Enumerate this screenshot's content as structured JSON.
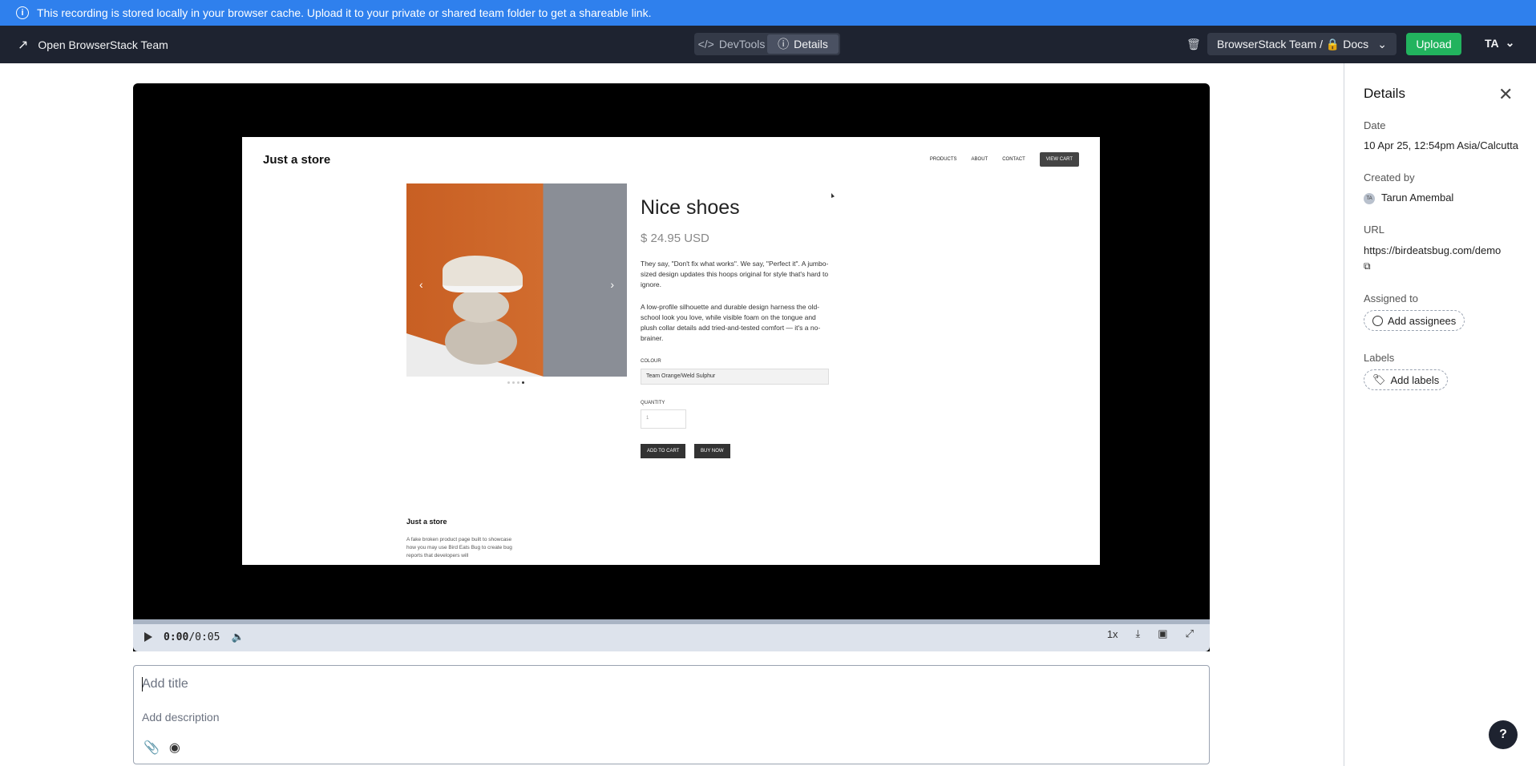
{
  "banner": {
    "text": "This recording is stored locally in your browser cache. Upload it to your private or shared team folder to get a shareable link."
  },
  "topbar": {
    "open_team_label": "Open BrowserStack Team",
    "toggle": {
      "devtools_label": "DevTools",
      "details_label": "Details",
      "active": "Details"
    },
    "team_select_label": "BrowserStack Team / 🔒 Docs",
    "upload_label": "Upload",
    "avatar_initials": "TA"
  },
  "recording": {
    "store_brand": "Just a store",
    "nav": [
      "PRODUCTS",
      "ABOUT",
      "CONTACT"
    ],
    "cart_label": "VIEW CART",
    "product_title": "Nice shoes",
    "product_price": "$ 24.95 USD",
    "desc_1": "They say, \"Don't fix what works\". We say, \"Perfect it\". A jumbo-sized design updates this hoops original for style that's hard to ignore.",
    "desc_2": "A low-profile silhouette and durable design harness the old-school look you love, while visible foam on the tongue and plush collar details add tried-and-tested comfort — it's a no-brainer.",
    "colour_label": "COLOUR",
    "colour_value": "Team Orange/Weld Sulphur",
    "quantity_label": "QUANTITY",
    "quantity_value": "1",
    "add_to_cart_label": "ADD TO CART",
    "buy_now_label": "BUY NOW",
    "footer_brand": "Just a store",
    "footer_desc": "A fake broken product page built to showcase how you may use Bird Eats Bug to create bug reports that developers will"
  },
  "player": {
    "current_time": "0:00",
    "duration": "/0:05",
    "progress": 0.0,
    "speed_label": "1x"
  },
  "editor": {
    "title_placeholder": "Add title",
    "description_placeholder": "Add description"
  },
  "details": {
    "heading": "Details",
    "date_label": "Date",
    "date_value": "10 Apr 25, 12:54pm Asia/Calcutta",
    "created_by_label": "Created by",
    "created_by_initials": "TA",
    "created_by_value": "Tarun Amembal",
    "url_label": "URL",
    "url_value": "https://birdeatsbug.com/demo",
    "assigned_label": "Assigned to",
    "assign_button": "Add assignees",
    "labels_label": "Labels",
    "labels_button": "Add labels"
  },
  "help_label": "?",
  "colors": {
    "banner": "#2f80ed",
    "topbar": "#1e2330",
    "upload": "#22b35e"
  }
}
